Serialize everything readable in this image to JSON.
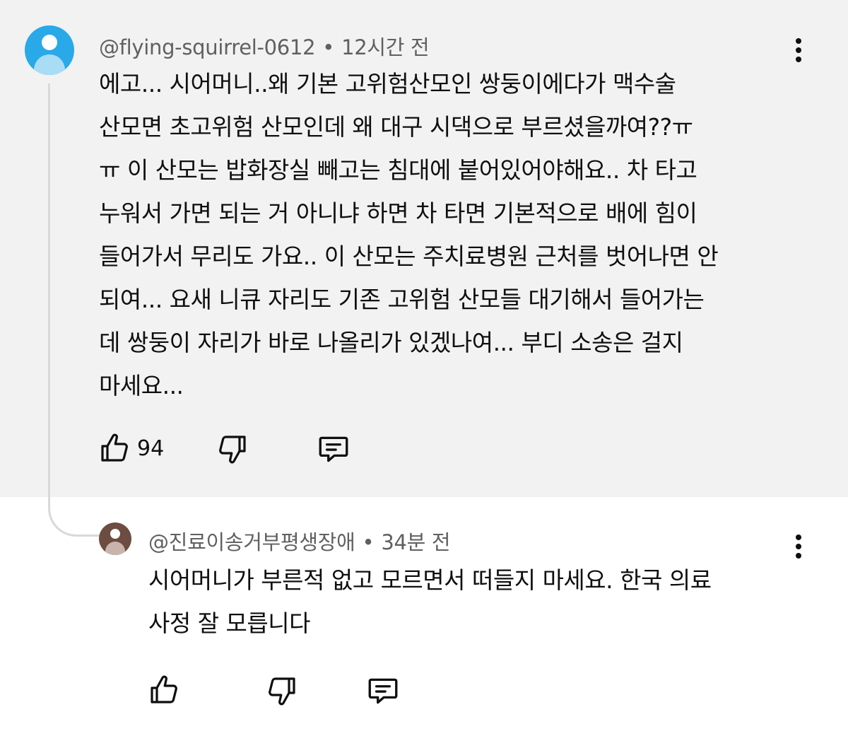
{
  "comment": {
    "author": "@flying-squirrel-0612",
    "separator": "•",
    "time": "12시간 전",
    "text": "에고... 시어머니..왜 기본 고위험산모인 쌍둥이에다가 맥수술\n산모면 초고위험 산모인데 왜 대구 시댁으로 부르셨을까여??ㅠ\nㅠ 이 산모는 밥화장실 빼고는 침대에 붙어있어야해요.. 차 타고\n누워서 가면 되는 거 아니냐 하면 차 타면 기본적으로 배에 힘이\n들어가서 무리도 가요..  이 산모는 주치료병원 근처를 벗어나면 안\n되여... 요새 니큐 자리도 기존 고위험 산모들 대기해서 들어가는\n데 쌍둥이 자리가 바로 나올리가 있겠나여... 부디 소송은 걸지\n마세요...",
    "like_count": "94",
    "icons": {
      "like": "thumbs-up-icon",
      "dislike": "thumbs-down-icon",
      "reply": "reply-comment-icon",
      "menu": "more-vert-icon"
    },
    "avatar_color": "#29a9e8"
  },
  "reply": {
    "author": "@진료이송거부평생장애",
    "separator": "•",
    "time": "34분 전",
    "text": "시어머니가 부른적 없고 모르면서 떠들지 마세요. 한국 의료\n사정 잘 모릅니다",
    "avatar_color": "#6d4c41"
  }
}
